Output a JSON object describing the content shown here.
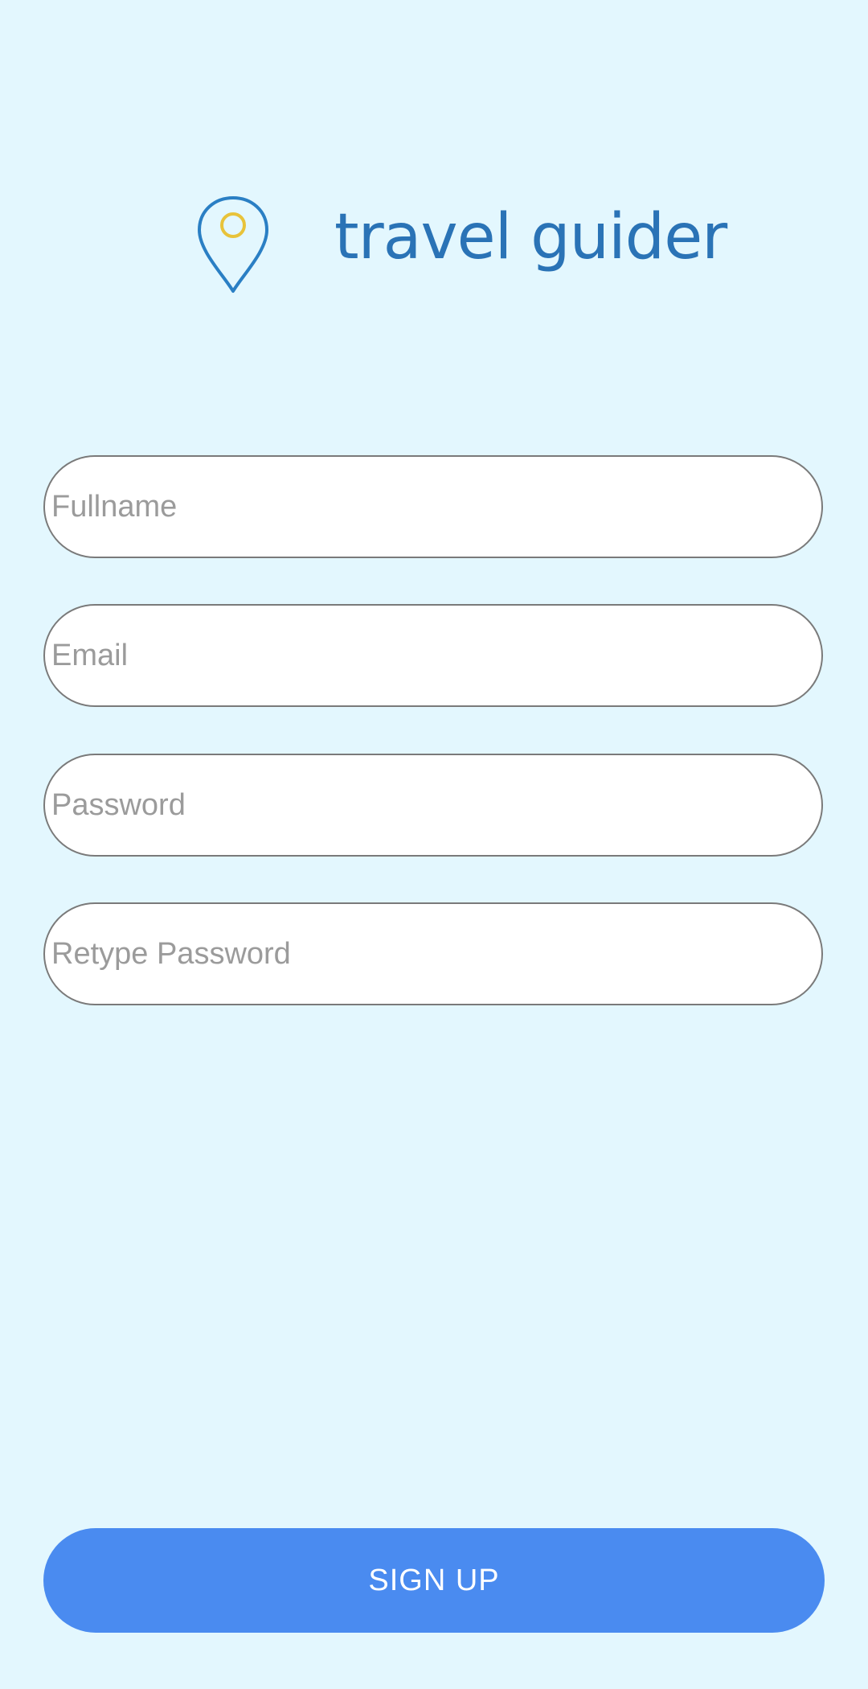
{
  "brand": {
    "name": "travel guider",
    "pin_color": "#2a7fc4",
    "pin_dot_color": "#e8c33a",
    "text_color": "#2a73b6"
  },
  "form": {
    "fullname_placeholder": "Fullname",
    "email_placeholder": "Email",
    "password_placeholder": "Password",
    "retype_password_placeholder": "Retype Password"
  },
  "actions": {
    "signup_label": "SIGN UP",
    "signup_color": "#4a8bf0"
  },
  "background_color": "#e3f7fe"
}
